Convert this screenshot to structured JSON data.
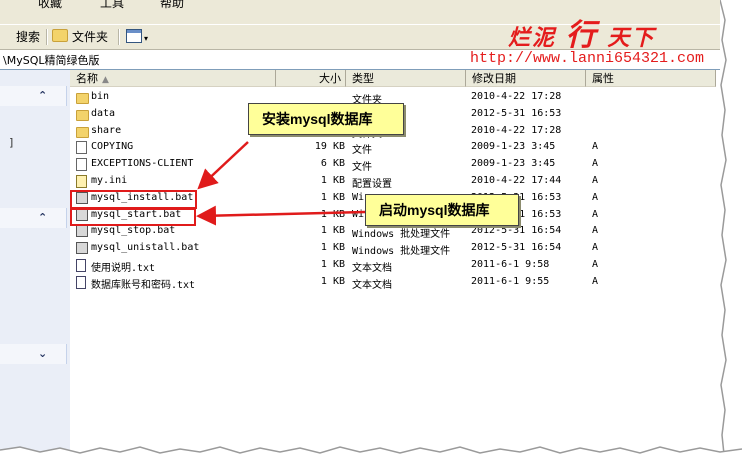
{
  "menubar": {
    "items": [
      "收藏",
      "工具",
      "帮助"
    ]
  },
  "toolbar": {
    "search_label": "搜索",
    "folders_label": "文件夹",
    "view_icon": "view-menu-icon"
  },
  "address": {
    "path": "\\MySQL精简绿色版"
  },
  "columns": {
    "name": "名称",
    "size": "大小",
    "type": "类型",
    "modified": "修改日期",
    "attributes": "属性"
  },
  "files": [
    {
      "icon": "folder",
      "name": "bin",
      "size": "",
      "type": "文件夹",
      "date": "2010-4-22 17:28",
      "attr": ""
    },
    {
      "icon": "folder",
      "name": "data",
      "size": "",
      "type": "文件夹",
      "date": "2012-5-31 16:53",
      "attr": ""
    },
    {
      "icon": "folder",
      "name": "share",
      "size": "",
      "type": "文件夹",
      "date": "2010-4-22 17:28",
      "attr": ""
    },
    {
      "icon": "file",
      "name": "COPYING",
      "size": "19 KB",
      "type": "文件",
      "date": "2009-1-23 3:45",
      "attr": "A"
    },
    {
      "icon": "file",
      "name": "EXCEPTIONS-CLIENT",
      "size": "6 KB",
      "type": "文件",
      "date": "2009-1-23 3:45",
      "attr": "A"
    },
    {
      "icon": "ini",
      "name": "my.ini",
      "size": "1 KB",
      "type": "配置设置",
      "date": "2010-4-22 17:44",
      "attr": "A"
    },
    {
      "icon": "bat",
      "name": "mysql_install.bat",
      "size": "1 KB",
      "type": "Wi",
      "date": "2012-5-31 16:53",
      "attr": "A"
    },
    {
      "icon": "bat",
      "name": "mysql_start.bat",
      "size": "1 KB",
      "type": "Wi",
      "date": "2012-5-31 16:53",
      "attr": "A"
    },
    {
      "icon": "bat",
      "name": "mysql_stop.bat",
      "size": "1 KB",
      "type": "Windows 批处理文件",
      "date": "2012-5-31 16:54",
      "attr": "A"
    },
    {
      "icon": "bat",
      "name": "mysql_unistall.bat",
      "size": "1 KB",
      "type": "Windows 批处理文件",
      "date": "2012-5-31 16:54",
      "attr": "A"
    },
    {
      "icon": "txt",
      "name": "使用说明.txt",
      "size": "1 KB",
      "type": "文本文档",
      "date": "2011-6-1 9:58",
      "attr": "A"
    },
    {
      "icon": "txt",
      "name": "数据库账号和密码.txt",
      "size": "1 KB",
      "type": "文本文档",
      "date": "2011-6-1 9:55",
      "attr": "A"
    }
  ],
  "callouts": {
    "install": "安装mysql数据库",
    "start": "启动mysql数据库"
  },
  "watermark": {
    "chars_1": "烂泥",
    "char_big": "行",
    "chars_2": "天下",
    "url": "http://www.lanni654321.com"
  },
  "leftpane": {
    "marker": "]"
  },
  "colors": {
    "highlight": "#e01b1b",
    "callout_bg": "#ffff99",
    "watermark": "#e41c1c"
  }
}
